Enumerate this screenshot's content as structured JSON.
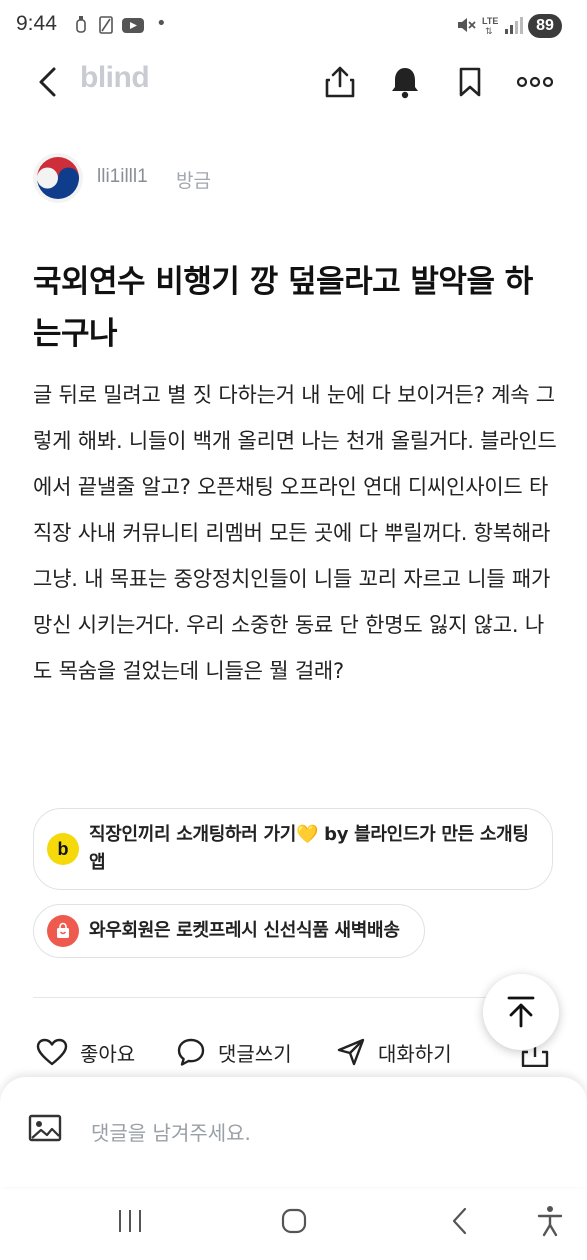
{
  "status_bar": {
    "time": "9:44",
    "dot": "•",
    "battery": "89"
  },
  "nav": {
    "brand": "blind"
  },
  "author": {
    "name": "lli1illl1",
    "time": "방금"
  },
  "post": {
    "title": "국외연수 비행기 깡 덮을라고 발악을 하는구나",
    "body": "글 뒤로 밀려고 별 짓 다하는거 내 눈에 다 보이거든? 계속 그렇게 해봐. 니들이 백개 올리면 나는 천개 올릴거다. 블라인드에서 끝낼줄 알고? 오픈채팅 오프라인 연대 디씨인사이드 타 직장 사내 커뮤니티 리멤버 모든 곳에 다 뿌릴꺼다. 항복해라 그냥. 내 목표는 중앙정치인들이 니들 꼬리 자르고 니들 패가망신 시키는거다. 우리 소중한 동료 단 한명도 잃지 않고. 나도 목숨을 걸었는데 니들은 뭘 걸래?"
  },
  "promos": [
    {
      "text": "직장인끼리 소개팅하러 가기💛 by 블라인드가 만든 소개팅앱",
      "icon_label": "b",
      "icon_color": "#f5d90a"
    },
    {
      "text": "와우회원은 로켓프레시 신선식품 새벽배송",
      "icon_color": "#ef5a4e"
    }
  ],
  "actions": {
    "like": "좋아요",
    "comment": "댓글쓰기",
    "chat": "대화하기"
  },
  "comment_input": {
    "placeholder": "댓글을 남겨주세요."
  },
  "icons": [
    "back-arrow-icon",
    "share-icon",
    "bell-icon",
    "bookmark-icon",
    "more-icon",
    "heart-icon",
    "comment-icon",
    "send-icon",
    "image-icon",
    "scroll-top-icon"
  ]
}
